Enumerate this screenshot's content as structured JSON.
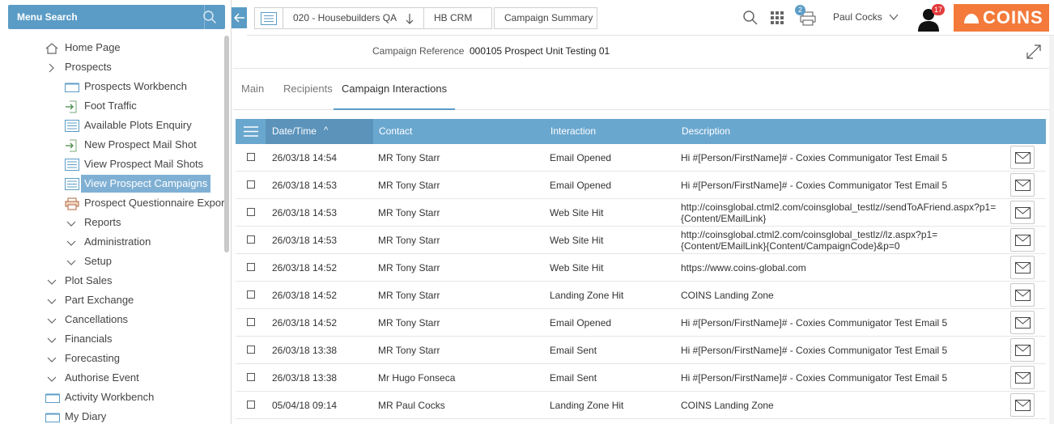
{
  "sidebar": {
    "search_label": "Menu Search",
    "items": [
      {
        "label": "Home Page",
        "icon": "home-icon",
        "indent": 0
      },
      {
        "label": "Prospects",
        "icon": "chevron-right-icon",
        "indent": 0
      },
      {
        "label": "Prospects Workbench",
        "icon": "workbench-icon",
        "indent": 1
      },
      {
        "label": "Foot Traffic",
        "icon": "arrow-in-icon",
        "indent": 1
      },
      {
        "label": "Available Plots Enquiry",
        "icon": "list-icon",
        "indent": 1
      },
      {
        "label": "New Prospect Mail Shot",
        "icon": "arrow-in-icon",
        "indent": 1
      },
      {
        "label": "View Prospect Mail Shots",
        "icon": "list-icon",
        "indent": 1
      },
      {
        "label": "View Prospect Campaigns",
        "icon": "list-icon",
        "indent": 1,
        "selected": true
      },
      {
        "label": "Prospect Questionnaire Expor",
        "icon": "printer-icon",
        "indent": 1
      },
      {
        "label": "Reports",
        "icon": "chevron-down-icon",
        "indent": 1
      },
      {
        "label": "Administration",
        "icon": "chevron-down-icon",
        "indent": 1
      },
      {
        "label": "Setup",
        "icon": "chevron-down-icon",
        "indent": 1
      },
      {
        "label": "Plot Sales",
        "icon": "chevron-down-icon",
        "indent": 0
      },
      {
        "label": "Part Exchange",
        "icon": "chevron-down-icon",
        "indent": 0
      },
      {
        "label": "Cancellations",
        "icon": "chevron-down-icon",
        "indent": 0
      },
      {
        "label": "Financials",
        "icon": "chevron-down-icon",
        "indent": 0
      },
      {
        "label": "Forecasting",
        "icon": "chevron-down-icon",
        "indent": 0
      },
      {
        "label": "Authorise Event",
        "icon": "chevron-down-icon",
        "indent": 0
      },
      {
        "label": "Activity Workbench",
        "icon": "workbench-icon",
        "indent": 0
      },
      {
        "label": "My Diary",
        "icon": "workbench-icon",
        "indent": 0
      }
    ]
  },
  "header": {
    "crumb_company": "020 - Housebuilders QA",
    "crumb_module": "HB CRM",
    "crumb_page": "Campaign Summary",
    "print_badge": "2",
    "user_name": "Paul Cocks",
    "user_badge": "17",
    "logo_text": "COINS"
  },
  "reference": {
    "label": "Campaign Reference",
    "value": "000105 Prospect Unit Testing 01"
  },
  "tabs": [
    "Main",
    "Recipients",
    "Campaign Interactions"
  ],
  "active_tab": 2,
  "grid": {
    "columns": [
      "Date/Time",
      "Contact",
      "Interaction",
      "Description"
    ],
    "sort_indicator": "^",
    "rows": [
      {
        "date": "26/03/18 14:54",
        "contact": "MR Tony Starr",
        "interaction": "Email Opened",
        "desc1": "Hi #[Person/FirstName]# - Coxies Communigator Test Email 5",
        "desc2": ""
      },
      {
        "date": "26/03/18 14:53",
        "contact": "MR Tony Starr",
        "interaction": "Email Opened",
        "desc1": "Hi #[Person/FirstName]# - Coxies Communigator Test Email 5",
        "desc2": ""
      },
      {
        "date": "26/03/18 14:53",
        "contact": "MR Tony Starr",
        "interaction": "Web Site Hit",
        "desc1": "http://coinsglobal.ctml2.com/coinsglobal_testlz//sendToAFriend.aspx?p1=",
        "desc2": "{Content/EMailLink}"
      },
      {
        "date": "26/03/18 14:53",
        "contact": "MR Tony Starr",
        "interaction": "Web Site Hit",
        "desc1": "http://coinsglobal.ctml2.com/coinsglobal_testlz//lz.aspx?p1=",
        "desc2": "{Content/EMailLink}{Content/CampaignCode}&p=0"
      },
      {
        "date": "26/03/18 14:52",
        "contact": "MR Tony Starr",
        "interaction": "Web Site Hit",
        "desc1": "https://www.coins-global.com",
        "desc2": ""
      },
      {
        "date": "26/03/18 14:52",
        "contact": "MR Tony Starr",
        "interaction": "Landing Zone Hit",
        "desc1": "COINS Landing Zone",
        "desc2": ""
      },
      {
        "date": "26/03/18 14:52",
        "contact": "MR Tony Starr",
        "interaction": "Email Opened",
        "desc1": "Hi #[Person/FirstName]# - Coxies Communigator Test Email 5",
        "desc2": ""
      },
      {
        "date": "26/03/18 13:38",
        "contact": "MR Tony Starr",
        "interaction": "Email Sent",
        "desc1": "Hi #[Person/FirstName]# - Coxies Communigator Test Email 5",
        "desc2": ""
      },
      {
        "date": "26/03/18 13:38",
        "contact": "Mr Hugo Fonseca",
        "interaction": "Email Sent",
        "desc1": "Hi #[Person/FirstName]# - Coxies Communigator Test Email 5",
        "desc2": ""
      },
      {
        "date": "05/04/18 09:14",
        "contact": "MR Paul Cocks",
        "interaction": "Landing Zone Hit",
        "desc1": "COINS Landing Zone",
        "desc2": ""
      }
    ]
  },
  "colors": {
    "accent": "#5b9cc6",
    "grid_header": "#6aa7cf",
    "logo": "#f37a3a",
    "badge": "#e23b3b"
  }
}
